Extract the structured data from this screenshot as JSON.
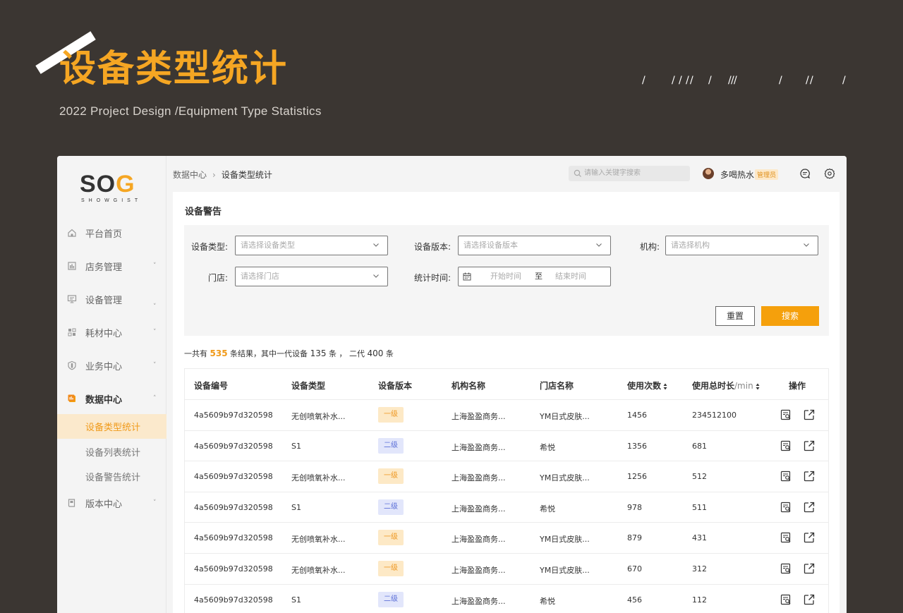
{
  "banner": {
    "title": "设备类型统计",
    "subtitle": "2022 Project Design  /Equipment Type Statistics"
  },
  "logo": {
    "text_a": "SO",
    "text_b": "G",
    "tagline": "SHOWGIST"
  },
  "sidebar": {
    "items": [
      {
        "label": "平台首页",
        "icon": "home-icon",
        "chevron": ""
      },
      {
        "label": "店务管理",
        "icon": "store-icon",
        "chevron": "˅"
      },
      {
        "label": "设备管理",
        "icon": "monitor-icon",
        "chevron": "˅"
      },
      {
        "label": "耗材中心",
        "icon": "grid-icon",
        "chevron": "˅"
      },
      {
        "label": "业务中心",
        "icon": "shield-icon",
        "chevron": "˅"
      },
      {
        "label": "数据中心",
        "icon": "data-icon",
        "chevron": "˄"
      },
      {
        "label": "版本中心",
        "icon": "book-icon",
        "chevron": "˅"
      }
    ],
    "subitems": [
      "设备类型统计",
      "设备列表统计",
      "设备警告统计"
    ]
  },
  "topbar": {
    "crumb_parent": "数据中心",
    "crumb_sep": "›",
    "crumb_current": "设备类型统计",
    "search_placeholder": "请输入关键字搜索",
    "username": "多喝热水",
    "role": "管理员"
  },
  "panel": {
    "title": "设备警告"
  },
  "filters": {
    "type_label": "设备类型:",
    "type_placeholder": "请选择设备类型",
    "version_label": "设备版本:",
    "version_placeholder": "请选择设备版本",
    "org_label": "机构:",
    "org_placeholder": "请选择机构",
    "store_label": "门店:",
    "store_placeholder": "请选择门店",
    "time_label": "统计时间:",
    "start_placeholder": "开始时间",
    "to": "至",
    "end_placeholder": "结束时间",
    "reset": "重置",
    "search": "搜索"
  },
  "summary": {
    "p1": "一共有 ",
    "total": "535",
    "p2": " 条结果，其中一代设备 ",
    "gen1": "135",
    "p3": " 条 ， 二代 ",
    "gen2": "400",
    "p4": " 条"
  },
  "table": {
    "headers": {
      "id": "设备编号",
      "type": "设备类型",
      "version": "设备版本",
      "org": "机构名称",
      "store": "门店名称",
      "count": "使用次数",
      "duration": "使用总时长",
      "duration_unit": "/min",
      "ops": "操作"
    },
    "rows": [
      {
        "id": "4a5609b97d320598",
        "type": "无创喷氧补水...",
        "version": "一级",
        "level": 1,
        "org": "上海盈盈商务...",
        "store": "YM日式皮肤...",
        "count": "1456",
        "duration": "234512100"
      },
      {
        "id": "4a5609b97d320598",
        "type": "S1",
        "version": "二级",
        "level": 2,
        "org": "上海盈盈商务...",
        "store": "希悦",
        "count": "1356",
        "duration": "681"
      },
      {
        "id": "4a5609b97d320598",
        "type": "无创喷氧补水...",
        "version": "一级",
        "level": 1,
        "org": "上海盈盈商务...",
        "store": "YM日式皮肤...",
        "count": "1256",
        "duration": "512"
      },
      {
        "id": "4a5609b97d320598",
        "type": "S1",
        "version": "二级",
        "level": 2,
        "org": "上海盈盈商务...",
        "store": "希悦",
        "count": "978",
        "duration": "511"
      },
      {
        "id": "4a5609b97d320598",
        "type": "无创喷氧补水...",
        "version": "一级",
        "level": 1,
        "org": "上海盈盈商务...",
        "store": "YM日式皮肤...",
        "count": "879",
        "duration": "431"
      },
      {
        "id": "4a5609b97d320598",
        "type": "无创喷氧补水...",
        "version": "一级",
        "level": 1,
        "org": "上海盈盈商务...",
        "store": "YM日式皮肤...",
        "count": "670",
        "duration": "312"
      },
      {
        "id": "4a5609b97d320598",
        "type": "S1",
        "version": "二级",
        "level": 2,
        "org": "上海盈盈商务...",
        "store": "希悦",
        "count": "456",
        "duration": "112"
      }
    ]
  },
  "colors": {
    "accent": "#f5a00c",
    "banner_bg": "#3b3632",
    "tag1_bg": "#fde9c6",
    "tag2_bg": "#e2e6fb"
  }
}
